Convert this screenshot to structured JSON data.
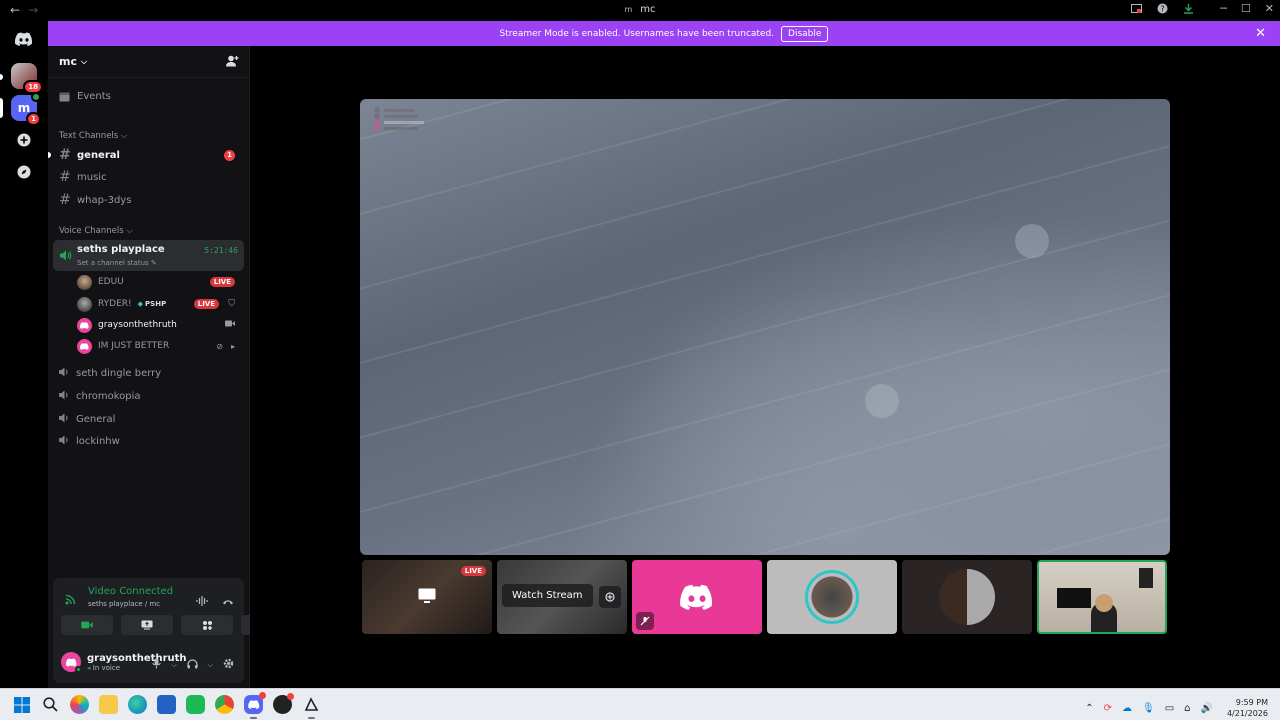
{
  "window": {
    "title": "mc",
    "title_icon": "m"
  },
  "banner": {
    "text": "Streamer Mode is enabled. Usernames have been truncated.",
    "button": "Disable"
  },
  "rail": {
    "badge_server1": "18",
    "badge_server2": "1",
    "server2_letter": "m"
  },
  "server": {
    "name": "mc",
    "events_label": "Events",
    "text_category": "Text Channels",
    "voice_category": "Voice Channels",
    "text_channels": [
      {
        "name": "general",
        "unread": "1"
      },
      {
        "name": "music"
      },
      {
        "name": "whap-3dys"
      }
    ],
    "active_voice": {
      "name": "seths playplace",
      "status": "Set a channel status",
      "timer": "5:21:46"
    },
    "voice_users": [
      {
        "name": "EDUU",
        "live": "LIVE"
      },
      {
        "name": "RYDER!",
        "tag": "PSHP",
        "live": "LIVE"
      },
      {
        "name": "graysonthethruth"
      },
      {
        "name": "IM JUST BETTER"
      }
    ],
    "voice_channels": [
      "seth dingle berry",
      "chromokopia",
      "General",
      "lockinhw"
    ]
  },
  "voice_panel": {
    "title": "Video Connected",
    "subtitle": "seths playplace / mc",
    "username": "graysonthethruth",
    "user_status": "In voice"
  },
  "stage": {
    "tile1_live": "LIVE",
    "tile2_label": "Watch Stream"
  },
  "taskbar": {
    "time": "9:59 PM",
    "date": "4/21/2026"
  },
  "colors": {
    "brand": "#5865f2",
    "banner": "#9b42f5",
    "live": "#da373c",
    "connected": "#23a55a"
  }
}
